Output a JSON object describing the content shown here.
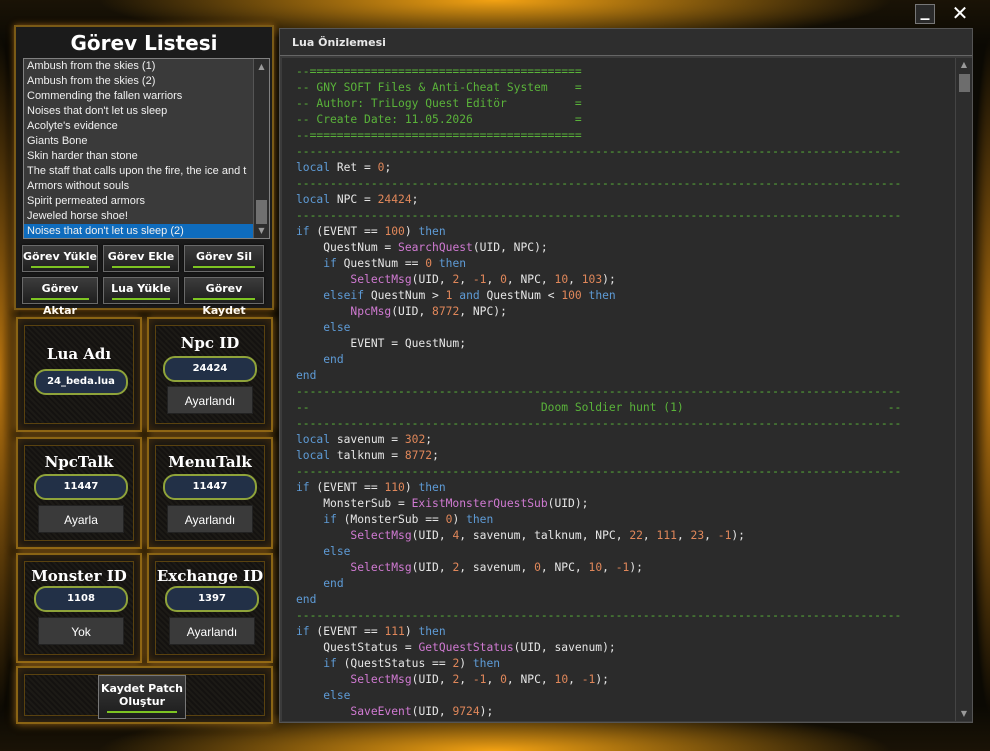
{
  "window": {
    "minimize_glyph": "_",
    "close_glyph": "✕"
  },
  "quest_panel": {
    "title": "Görev Listesi",
    "items": [
      "Ambush from the skies (1)",
      "Ambush from the skies (2)",
      "Commending the fallen warriors",
      "Noises that don't let us sleep",
      "Acolyte's evidence",
      "Giants Bone",
      "Skin harder than stone",
      "The staff that calls upon the fire, the ice and t",
      "Armors without souls",
      "Spirit permeated armors",
      "Jeweled horse shoe!",
      "Noises that don't let us sleep (2)"
    ],
    "selected_index": 11,
    "buttons_row1": [
      "Görev Yükle",
      "Görev Ekle",
      "Görev Sil"
    ],
    "buttons_row2": [
      "Görev Aktar",
      "Lua Yükle",
      "Görev Kaydet"
    ]
  },
  "lua_box": {
    "title": "Lua Adı",
    "value": "24_beda.lua"
  },
  "npc_box": {
    "title": "Npc ID",
    "value": "24424",
    "status": "Ayarlandı"
  },
  "npctalk_box": {
    "title": "NpcTalk",
    "value": "11447",
    "status": "Ayarla"
  },
  "menutalk_box": {
    "title": "MenuTalk",
    "value": "11447",
    "status": "Ayarlandı"
  },
  "monster_box": {
    "title": "Monster ID",
    "value": "1108",
    "status": "Yok"
  },
  "exchange_box": {
    "title": "Exchange ID",
    "value": "1397",
    "status": "Ayarlandı"
  },
  "save_button": {
    "line1": "Kaydet  Patch",
    "line2": "Oluştur"
  },
  "editor": {
    "title": "Lua Önizlemesi",
    "lines": [
      [
        [
          "--========================================",
          "cm"
        ]
      ],
      [
        [
          "-- GNY SOFT Files & Anti-Cheat System    =",
          "cm"
        ]
      ],
      [
        [
          "-- Author: TriLogy Quest Editör          =",
          "cm"
        ]
      ],
      [
        [
          "-- Create Date: 11.05.2026               =",
          "cm"
        ]
      ],
      [
        [
          "--========================================",
          "cm"
        ]
      ],
      [
        [
          "-----------------------------------------------------------------------------------------",
          "cm"
        ]
      ],
      [
        [
          "local",
          "kw"
        ],
        [
          " Ret = ",
          ""
        ],
        [
          "0",
          "nm"
        ],
        [
          ";",
          ""
        ]
      ],
      [
        [
          "-----------------------------------------------------------------------------------------",
          "cm"
        ]
      ],
      [
        [
          "local",
          "kw"
        ],
        [
          " NPC = ",
          ""
        ],
        [
          "24424",
          "nm"
        ],
        [
          ";",
          ""
        ]
      ],
      [
        [
          "-----------------------------------------------------------------------------------------",
          "cm"
        ]
      ],
      [
        [
          "if",
          "kw"
        ],
        [
          " (EVENT == ",
          ""
        ],
        [
          "100",
          "nm"
        ],
        [
          ") ",
          ""
        ],
        [
          "then",
          "kw"
        ]
      ],
      [
        [
          "    QuestNum = ",
          ""
        ],
        [
          "SearchQuest",
          "fn"
        ],
        [
          "(UID, NPC);",
          ""
        ]
      ],
      [
        [
          "    ",
          ""
        ],
        [
          "if",
          "kw"
        ],
        [
          " QuestNum == ",
          ""
        ],
        [
          "0",
          "nm"
        ],
        [
          " ",
          ""
        ],
        [
          "then",
          "kw"
        ]
      ],
      [
        [
          "        ",
          ""
        ],
        [
          "SelectMsg",
          "fn"
        ],
        [
          "(UID, ",
          ""
        ],
        [
          "2",
          "nm"
        ],
        [
          ", ",
          ""
        ],
        [
          "-1",
          "nm"
        ],
        [
          ", ",
          ""
        ],
        [
          "0",
          "nm"
        ],
        [
          ", NPC, ",
          ""
        ],
        [
          "10",
          "nm"
        ],
        [
          ", ",
          ""
        ],
        [
          "103",
          "nm"
        ],
        [
          ");",
          ""
        ]
      ],
      [
        [
          "    ",
          ""
        ],
        [
          "elseif",
          "kw"
        ],
        [
          " QuestNum > ",
          ""
        ],
        [
          "1",
          "nm"
        ],
        [
          " ",
          ""
        ],
        [
          "and",
          "kw"
        ],
        [
          " QuestNum < ",
          ""
        ],
        [
          "100",
          "nm"
        ],
        [
          " ",
          ""
        ],
        [
          "then",
          "kw"
        ]
      ],
      [
        [
          "        ",
          ""
        ],
        [
          "NpcMsg",
          "fn"
        ],
        [
          "(UID, ",
          ""
        ],
        [
          "8772",
          "nm"
        ],
        [
          ", NPC);",
          ""
        ]
      ],
      [
        [
          "    ",
          ""
        ],
        [
          "else",
          "kw"
        ]
      ],
      [
        [
          "        EVENT = QuestNum;",
          ""
        ]
      ],
      [
        [
          "    ",
          ""
        ],
        [
          "end",
          "kw"
        ]
      ],
      [
        [
          "end",
          "kw"
        ]
      ],
      [
        [
          "-----------------------------------------------------------------------------------------",
          "cm"
        ]
      ],
      [
        [
          "--                                  Doom Soldier hunt (1)                              --",
          "cm"
        ]
      ],
      [
        [
          "-----------------------------------------------------------------------------------------",
          "cm"
        ]
      ],
      [
        [
          "local",
          "kw"
        ],
        [
          " savenum = ",
          ""
        ],
        [
          "302",
          "nm"
        ],
        [
          ";",
          ""
        ]
      ],
      [
        [
          "local",
          "kw"
        ],
        [
          " talknum = ",
          ""
        ],
        [
          "8772",
          "nm"
        ],
        [
          ";",
          ""
        ]
      ],
      [
        [
          "-----------------------------------------------------------------------------------------",
          "cm"
        ]
      ],
      [
        [
          "if",
          "kw"
        ],
        [
          " (EVENT == ",
          ""
        ],
        [
          "110",
          "nm"
        ],
        [
          ") ",
          ""
        ],
        [
          "then",
          "kw"
        ]
      ],
      [
        [
          "    MonsterSub = ",
          ""
        ],
        [
          "ExistMonsterQuestSub",
          "fn"
        ],
        [
          "(UID);",
          ""
        ]
      ],
      [
        [
          "    ",
          ""
        ],
        [
          "if",
          "kw"
        ],
        [
          " (MonsterSub == ",
          ""
        ],
        [
          "0",
          "nm"
        ],
        [
          ") ",
          ""
        ],
        [
          "then",
          "kw"
        ]
      ],
      [
        [
          "        ",
          ""
        ],
        [
          "SelectMsg",
          "fn"
        ],
        [
          "(UID, ",
          ""
        ],
        [
          "4",
          "nm"
        ],
        [
          ", savenum, talknum, NPC, ",
          ""
        ],
        [
          "22",
          "nm"
        ],
        [
          ", ",
          ""
        ],
        [
          "111",
          "nm"
        ],
        [
          ", ",
          ""
        ],
        [
          "23",
          "nm"
        ],
        [
          ", ",
          ""
        ],
        [
          "-1",
          "nm"
        ],
        [
          ");",
          ""
        ]
      ],
      [
        [
          "    ",
          ""
        ],
        [
          "else",
          "kw"
        ]
      ],
      [
        [
          "        ",
          ""
        ],
        [
          "SelectMsg",
          "fn"
        ],
        [
          "(UID, ",
          ""
        ],
        [
          "2",
          "nm"
        ],
        [
          ", savenum, ",
          ""
        ],
        [
          "0",
          "nm"
        ],
        [
          ", NPC, ",
          ""
        ],
        [
          "10",
          "nm"
        ],
        [
          ", ",
          ""
        ],
        [
          "-1",
          "nm"
        ],
        [
          ");",
          ""
        ]
      ],
      [
        [
          "    ",
          ""
        ],
        [
          "end",
          "kw"
        ]
      ],
      [
        [
          "end",
          "kw"
        ]
      ],
      [
        [
          "-----------------------------------------------------------------------------------------",
          "cm"
        ]
      ],
      [
        [
          "if",
          "kw"
        ],
        [
          " (EVENT == ",
          ""
        ],
        [
          "111",
          "nm"
        ],
        [
          ") ",
          ""
        ],
        [
          "then",
          "kw"
        ]
      ],
      [
        [
          "    QuestStatus = ",
          ""
        ],
        [
          "GetQuestStatus",
          "fn"
        ],
        [
          "(UID, savenum);",
          ""
        ]
      ],
      [
        [
          "    ",
          ""
        ],
        [
          "if",
          "kw"
        ],
        [
          " (QuestStatus == ",
          ""
        ],
        [
          "2",
          "nm"
        ],
        [
          ") ",
          ""
        ],
        [
          "then",
          "kw"
        ]
      ],
      [
        [
          "        ",
          ""
        ],
        [
          "SelectMsg",
          "fn"
        ],
        [
          "(UID, ",
          ""
        ],
        [
          "2",
          "nm"
        ],
        [
          ", ",
          ""
        ],
        [
          "-1",
          "nm"
        ],
        [
          ", ",
          ""
        ],
        [
          "0",
          "nm"
        ],
        [
          ", NPC, ",
          ""
        ],
        [
          "10",
          "nm"
        ],
        [
          ", ",
          ""
        ],
        [
          "-1",
          "nm"
        ],
        [
          ");",
          ""
        ]
      ],
      [
        [
          "    ",
          ""
        ],
        [
          "else",
          "kw"
        ]
      ],
      [
        [
          "        ",
          ""
        ],
        [
          "SaveEvent",
          "fn"
        ],
        [
          "(UID, ",
          ""
        ],
        [
          "9724",
          "nm"
        ],
        [
          ");",
          ""
        ]
      ]
    ]
  }
}
